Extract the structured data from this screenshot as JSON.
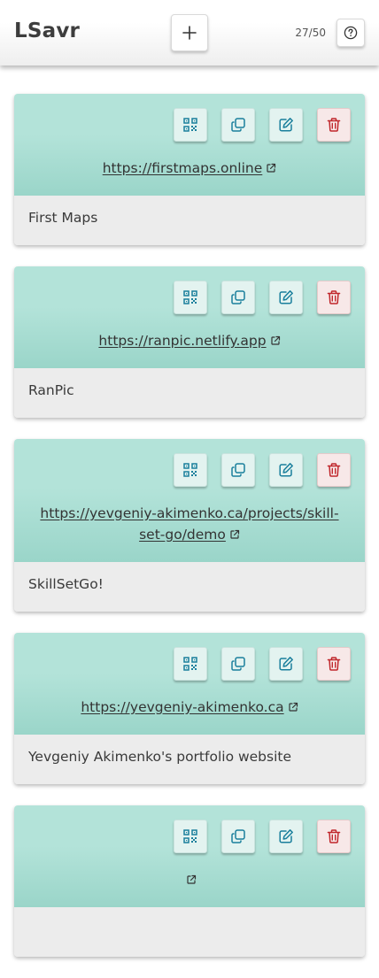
{
  "app": {
    "title": "LSavr",
    "counter": "27/50",
    "accent_color": "#b3e3d9",
    "icon_color": "#1a7f9c",
    "delete_color": "#c0262b"
  },
  "header": {
    "add_icon": "plus-icon",
    "help_icon": "question-circle-icon"
  },
  "cards": [
    {
      "url": "https://firstmaps.online",
      "name": "First Maps"
    },
    {
      "url": "https://ranpic.netlify.app",
      "name": "RanPic"
    },
    {
      "url": "https://yevgeniy-akimenko.ca/projects/skill-set-go/demo",
      "name": "SkillSetGo!"
    },
    {
      "url": "https://yevgeniy-akimenko.ca",
      "name": "Yevgeniy Akimenko's portfolio website"
    },
    {
      "url": "",
      "name": ""
    }
  ],
  "card_actions": [
    "qr-code-icon",
    "copy-icon",
    "edit-icon",
    "trash-icon"
  ]
}
